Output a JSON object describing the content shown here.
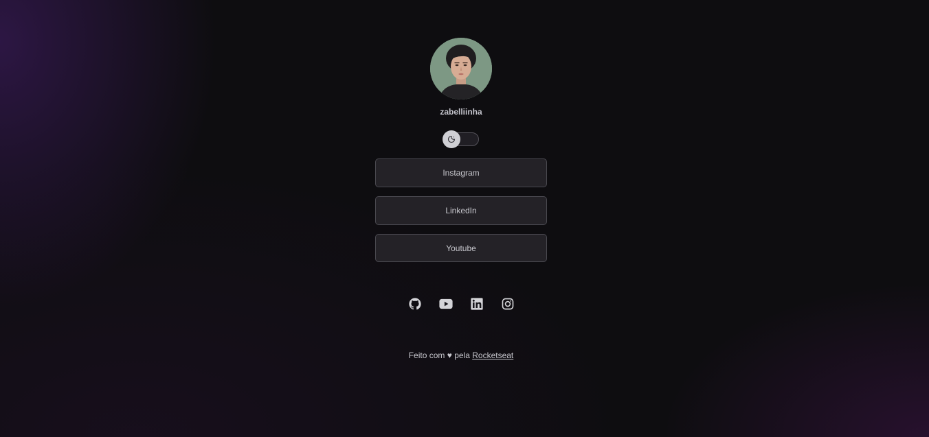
{
  "profile": {
    "username": "zabelliinha"
  },
  "theme_switch": {
    "icon": "moon-sun-icon",
    "state": "dark"
  },
  "links": [
    {
      "label": "Instagram"
    },
    {
      "label": "LinkedIn"
    },
    {
      "label": "Youtube"
    }
  ],
  "socials": [
    {
      "name": "github-icon"
    },
    {
      "name": "youtube-icon"
    },
    {
      "name": "linkedin-icon"
    },
    {
      "name": "instagram-icon"
    }
  ],
  "footer": {
    "text_prefix": "Feito com ♥ pela",
    "link_label": "Rocketseat"
  },
  "colors": {
    "background": "#0e0d10",
    "accent_purple": "#4a1e6e",
    "text": "#c8c8ce",
    "button_bg": "#28272c",
    "button_border": "#4a4950"
  }
}
